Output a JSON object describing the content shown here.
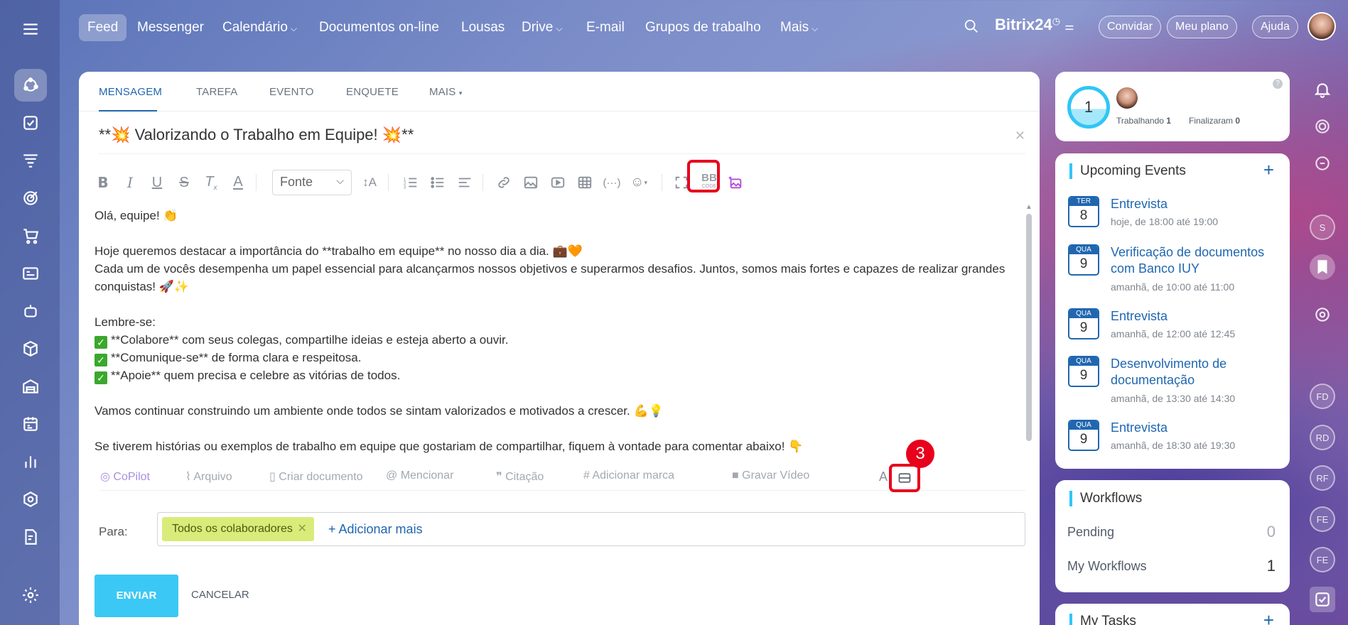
{
  "nav": {
    "items": [
      {
        "label": "Feed"
      },
      {
        "label": "Messenger"
      },
      {
        "label": "Calendário"
      },
      {
        "label": "Documentos on-line"
      },
      {
        "label": "Lousas"
      },
      {
        "label": "Drive"
      },
      {
        "label": "E-mail"
      },
      {
        "label": "Grupos de trabalho"
      },
      {
        "label": "Mais"
      }
    ],
    "brand": "Bitrix24",
    "invite": "Convidar",
    "plan": "Meu plano",
    "help": "Ajuda"
  },
  "composer": {
    "tabs": [
      "MENSAGEM",
      "TAREFA",
      "EVENTO",
      "ENQUETE",
      "MAIS"
    ],
    "title": "**💥 Valorizando o Trabalho em Equipe! 💥**",
    "font_label": "Fonte",
    "bbcode_label": "BB",
    "bbcode_sub": "CODE",
    "body": {
      "l1": "Olá, equipe! 👏",
      "l2": "Hoje queremos destacar a importância do **trabalho em equipe** no nosso dia a dia. 💼🧡",
      "l3": "Cada um de vocês desempenha um papel essencial para alcançarmos nossos objetivos e superarmos desafios. Juntos, somos mais fortes e capazes de realizar grandes",
      "l4": "conquistas! 🚀✨",
      "l5": "Lembre-se:",
      "l6": "**Colabore** com seus colegas, compartilhe ideias e esteja aberto a ouvir.",
      "l7": "**Comunique-se** de forma clara e respeitosa.",
      "l8": "**Apoie** quem precisa e celebre as vitórias de todos.",
      "l9": "Vamos continuar construindo um ambiente onde todos se sintam valorizados e motivados a crescer. 💪💡",
      "l10": "Se tiverem histórias ou exemplos de trabalho em equipe que gostariam de compartilhar, fiquem à vontade para comentar abaixo! 👇"
    },
    "attach": {
      "copilot": "CoPilot",
      "file": "Arquivo",
      "doc": "Criar documento",
      "mention": "Mencionar",
      "quote": "Citação",
      "tag": "Adicionar marca",
      "video": "Gravar Vídeo"
    },
    "badge_number": "3",
    "to_label": "Para:",
    "recipient_chip": "Todos os colaboradores",
    "add_more": "+ Adicionar mais",
    "send": "ENVIAR",
    "cancel": "CANCELAR"
  },
  "status": {
    "count": "1",
    "working_label": "Trabalhando",
    "working_value": "1",
    "finished_label": "Finalizaram",
    "finished_value": "0"
  },
  "events": {
    "title": "Upcoming Events",
    "items": [
      {
        "dow": "TER",
        "day": "8",
        "title": "Entrevista",
        "time": "hoje, de 18:00 até 19:00"
      },
      {
        "dow": "QUA",
        "day": "9",
        "title": "Verificação de documentos com Banco IUY",
        "time": "amanhã, de 10:00 até 11:00"
      },
      {
        "dow": "QUA",
        "day": "9",
        "title": "Entrevista",
        "time": "amanhã, de 12:00 até 12:45"
      },
      {
        "dow": "QUA",
        "day": "9",
        "title": "Desenvolvimento de documentação",
        "time": "amanhã, de 13:30 até 14:30"
      },
      {
        "dow": "QUA",
        "day": "9",
        "title": "Entrevista",
        "time": "amanhã, de 18:30 até 19:30"
      }
    ]
  },
  "workflows": {
    "title": "Workflows",
    "pending_label": "Pending",
    "pending_value": "0",
    "mine_label": "My Workflows",
    "mine_value": "1"
  },
  "tasks": {
    "title": "My Tasks"
  },
  "right_rail": {
    "avatars": [
      "FD",
      "RD",
      "RF",
      "FE",
      "FE"
    ]
  }
}
